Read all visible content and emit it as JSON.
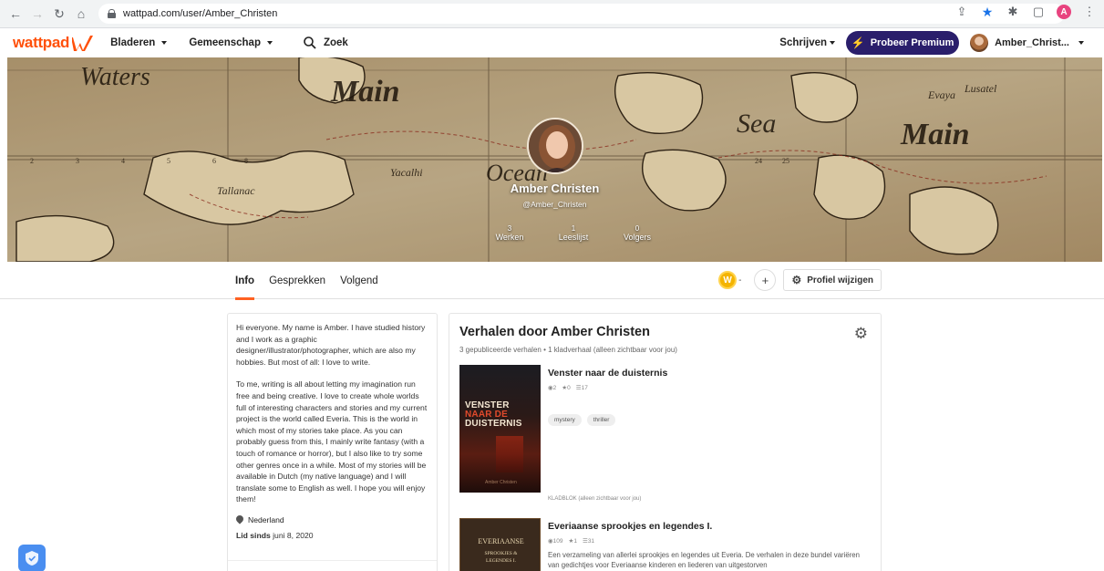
{
  "browser": {
    "url": "wattpad.com/user/Amber_Christen",
    "profile_initial": "A"
  },
  "nav": {
    "logo": "wattpad",
    "browse": "Bladeren",
    "community": "Gemeenschap",
    "search": "Zoek",
    "write": "Schrijven",
    "premium": "Probeer Premium",
    "username": "Amber_Christ..."
  },
  "profile": {
    "name": "Amber Christen",
    "handle": "@Amber_Christen",
    "stats": [
      {
        "value": "3",
        "label": "Werken"
      },
      {
        "value": "1",
        "label": "Leeslijst"
      },
      {
        "value": "0",
        "label": "Volgers"
      }
    ]
  },
  "tabs": [
    "Info",
    "Gesprekken",
    "Volgend"
  ],
  "actions": {
    "coin_count": "-",
    "plus": "+",
    "edit": "Profiel wijzigen"
  },
  "about": {
    "paragraphs": [
      "Hi everyone. My name is Amber. I have studied history and I work as a graphic designer/illustrator/photographer, which are also my hobbies. But most of all: I love to write.",
      "To me, writing is all about letting my imagination run free and being creative. I love to create whole worlds full of interesting characters and stories and my current project is the world called Everia. This is the world in which most of my stories take place. As you can probably guess from this, I mainly write fantasy (with a touch of romance or horror), but I also like to try some other genres once in a while. Most of my stories will be available in Dutch (my native language) and I will translate some to English as well. I hope you will enjoy them!"
    ],
    "location": "Nederland",
    "member_label": "Lid sinds",
    "member_date": "juni 8, 2020"
  },
  "stories": {
    "heading": "Verhalen door Amber Christen",
    "subheading": "3 gepubliceerde verhalen • 1 kladverhaal (alleen zichtbaar voor jou)",
    "items": [
      {
        "title": "Venster naar de duisternis",
        "reads": "2",
        "votes": "0",
        "parts": "17",
        "tags": [
          "mystery",
          "thriller"
        ],
        "draft": "KLADBLOK (alleen zichtbaar voor jou)",
        "cover_lines": [
          "VENSTER",
          "NAAR DE",
          "DUISTERNIS"
        ],
        "cover_author": "Amber Christen"
      },
      {
        "title": "Everiaanse sprookjes en legendes I.",
        "reads": "109",
        "votes": "1",
        "parts": "31",
        "description": "Een verzameling van allerlei sprookjes en legendes uit Everia. De verhalen in deze bundel variëren van gedichtjes voor Everiaanse kinderen en liederen van uitgestorven",
        "cover_title": "EVERIAANSE",
        "cover_sub1": "SPROOKJES &",
        "cover_sub2": "LEGENDES I."
      }
    ]
  },
  "colors": {
    "accent": "#ff500a",
    "premium_bg": "#2a1e6b",
    "tab_underline": "#ff6122"
  }
}
